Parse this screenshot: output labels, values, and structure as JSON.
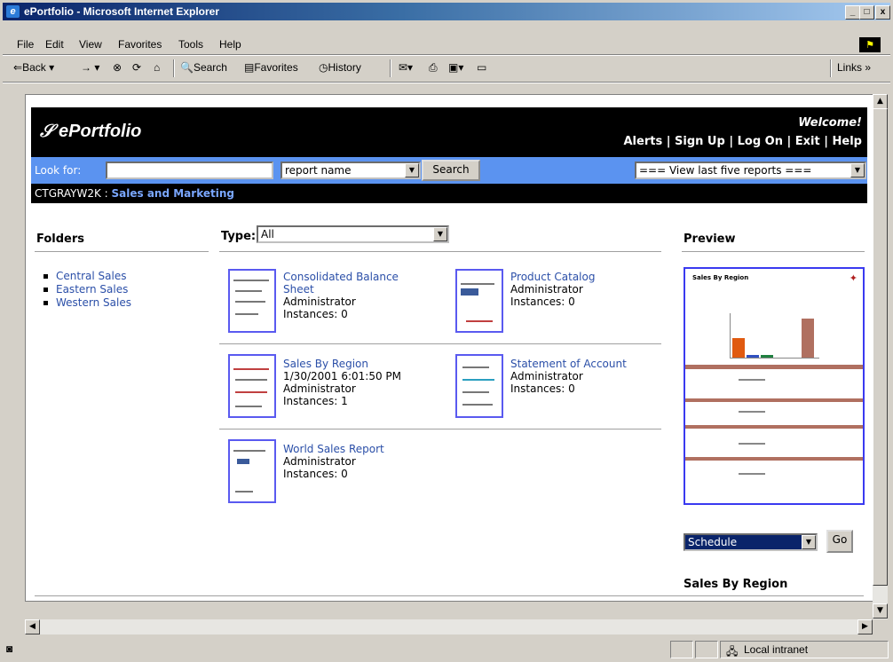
{
  "window": {
    "title": "ePortfolio - Microsoft Internet Explorer",
    "min": "_",
    "max": "□",
    "close": "x"
  },
  "menu": [
    "File",
    "Edit",
    "View",
    "Favorites",
    "Tools",
    "Help"
  ],
  "toolbar": {
    "back": "Back",
    "forward": "→",
    "search": "Search",
    "favorites": "Favorites",
    "history": "History",
    "links": "Links"
  },
  "page": {
    "logo": "ePortfolio",
    "welcome": "Welcome!",
    "links": [
      "Alerts",
      "Sign Up",
      "Log On",
      "Exit",
      "Help"
    ],
    "separator": " | ",
    "look_for": "Look for:",
    "search_type": "report name",
    "search_button": "Search",
    "recent": "=== View last five reports ===",
    "crumb_server": "CTGRAYW2K",
    "crumb_sep": " : ",
    "crumb_folder": "Sales and Marketing",
    "folders_heading": "Folders",
    "folders": [
      "Central Sales",
      "Eastern Sales",
      "Western Sales"
    ],
    "type_label": "Type:",
    "type_value": "All",
    "preview_heading": "Preview",
    "reports": [
      {
        "title1": "Consolidated Balance",
        "title2": "Sheet",
        "line1": "Administrator",
        "line2": "Instances: 0"
      },
      {
        "title1": "Product Catalog",
        "line1": "Administrator",
        "line2": "Instances: 0"
      },
      {
        "title1": "Sales By Region",
        "line0": "1/30/2001 6:01:50 PM",
        "line1": "Administrator",
        "line2": "Instances: 1"
      },
      {
        "title1": "Statement of Account",
        "line1": "Administrator",
        "line2": "Instances: 0"
      },
      {
        "title1": "World Sales Report",
        "line1": "Administrator",
        "line2": "Instances: 0"
      }
    ],
    "action": "Schedule",
    "go": "Go",
    "selected_report": "Sales By Region",
    "preview_title": "Sales By Region"
  },
  "status": {
    "zone": "Local intranet"
  }
}
